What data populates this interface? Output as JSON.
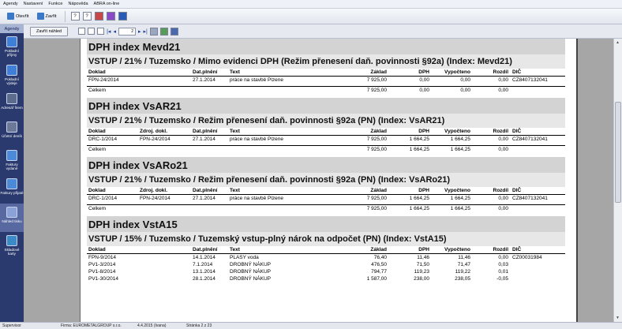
{
  "menu": [
    "Agendy",
    "Nastavení",
    "Funkce",
    "Nápověda",
    "ABRA on-line"
  ],
  "toolbar": {
    "open_label": "Otevřít",
    "close_label": "Zavřít"
  },
  "nav": {
    "header": "Agendy",
    "items": [
      {
        "label": "Pokladní příjmy",
        "color": "#3f7fd8"
      },
      {
        "label": "Pokladní výdeje",
        "color": "#3f7fd8"
      },
      {
        "label": "Adresář firem",
        "color": "#5c6c8c"
      },
      {
        "label": "Účetní deník",
        "color": "#6c7898"
      },
      {
        "label": "Faktury vydané",
        "color": "#4a8ad8"
      },
      {
        "label": "Faktury přijaté",
        "color": "#4a8ad8"
      },
      {
        "label": "Náhled tisku",
        "color": "#8aa2d8"
      },
      {
        "label": "Skladové karty",
        "color": "#3a8ac8"
      }
    ]
  },
  "preview_toolbar": {
    "close_preview_label": "Zavřít náhled",
    "page_value": "2"
  },
  "report": {
    "sections": [
      {
        "title": "DPH index Mevd21",
        "subtitle": "VSTUP / 21% / Tuzemsko / Mimo evidenci DPH (Režim přenesení daň. povinnosti §92a) (Index: Mevd21)",
        "has_zdroj": false,
        "rows": [
          {
            "doklad": "FPN-24/2014",
            "zdroj": "",
            "dat": "27.1.2014",
            "text": "práce na stavbě Plzene",
            "zaklad": "7 925,00",
            "dph": "0,00",
            "vyp": "0,00",
            "rozd": "0,00",
            "dic": "CZ8407132041"
          }
        ],
        "total": {
          "label": "Celkem",
          "zaklad": "7 925,00",
          "dph": "0,00",
          "vyp": "0,00",
          "rozd": "0,00"
        }
      },
      {
        "title": "DPH index VsAR21",
        "subtitle": "VSTUP / 21% / Tuzemsko / Režim přenesení daň. povinnosti §92a (PN) (Index: VsAR21)",
        "has_zdroj": true,
        "rows": [
          {
            "doklad": "DRC-1/2014",
            "zdroj": "FPN-24/2014",
            "dat": "27.1.2014",
            "text": "práce na stavbě Plzene",
            "zaklad": "7 925,00",
            "dph": "1 664,25",
            "vyp": "1 664,25",
            "rozd": "0,00",
            "dic": "CZ8407132041"
          }
        ],
        "total": {
          "label": "Celkem",
          "zaklad": "7 925,00",
          "dph": "1 664,25",
          "vyp": "1 664,25",
          "rozd": "0,00"
        }
      },
      {
        "title": "DPH index VsARo21",
        "subtitle": "VSTUP / 21% / Tuzemsko / Režim přenesení daň. povinnosti §92a (PN) (Index: VsARo21)",
        "has_zdroj": true,
        "rows": [
          {
            "doklad": "DRC-1/2014",
            "zdroj": "FPN-24/2014",
            "dat": "27.1.2014",
            "text": "práce na stavbě Plzene",
            "zaklad": "7 925,00",
            "dph": "1 664,25",
            "vyp": "1 664,25",
            "rozd": "0,00",
            "dic": "CZ8407132041"
          }
        ],
        "total": {
          "label": "Celkem",
          "zaklad": "7 925,00",
          "dph": "1 664,25",
          "vyp": "1 664,25",
          "rozd": "0,00"
        }
      },
      {
        "title": "DPH index VstA15",
        "subtitle": "VSTUP / 15% / Tuzemsko / Tuzemský vstup-plný nárok na odpočet (PN) (Index: VstA15)",
        "has_zdroj": false,
        "rows": [
          {
            "doklad": "FPN-9/2014",
            "zdroj": "",
            "dat": "14.1.2014",
            "text": "PLASY voda",
            "zaklad": "76,40",
            "dph": "11,46",
            "vyp": "11,46",
            "rozd": "0,00",
            "dic": "CZ00031984"
          },
          {
            "doklad": "PV1-3/2014",
            "zdroj": "",
            "dat": "7.1.2014",
            "text": "DROBNÝ NÁKUP",
            "zaklad": "476,50",
            "dph": "71,50",
            "vyp": "71,47",
            "rozd": "0,03",
            "dic": ""
          },
          {
            "doklad": "PV1-8/2014",
            "zdroj": "",
            "dat": "13.1.2014",
            "text": "DROBNÝ NÁKUP",
            "zaklad": "794,77",
            "dph": "119,23",
            "vyp": "119,22",
            "rozd": "0,01",
            "dic": ""
          },
          {
            "doklad": "PV1-30/2014",
            "zdroj": "",
            "dat": "28.1.2014",
            "text": "DROBNÝ NÁKUP",
            "zaklad": "1 587,00",
            "dph": "238,00",
            "vyp": "238,05",
            "rozd": "-0,05",
            "dic": ""
          }
        ],
        "total": null
      }
    ],
    "headers": {
      "doklad": "Doklad",
      "zdroj": "Zdroj. dokl.",
      "dat": "Dat.plnění",
      "text": "Text",
      "zaklad": "Základ",
      "dph": "DPH",
      "vyp": "Vypočteno",
      "rozd": "Rozdíl",
      "dic": "DIČ"
    }
  },
  "status": {
    "user": "Supervisor",
    "company": "Firma: EUROMETALGROUP s.r.o.",
    "date": "4.4.2015 (Ivana)",
    "page": "Stránka 2 z 23"
  }
}
